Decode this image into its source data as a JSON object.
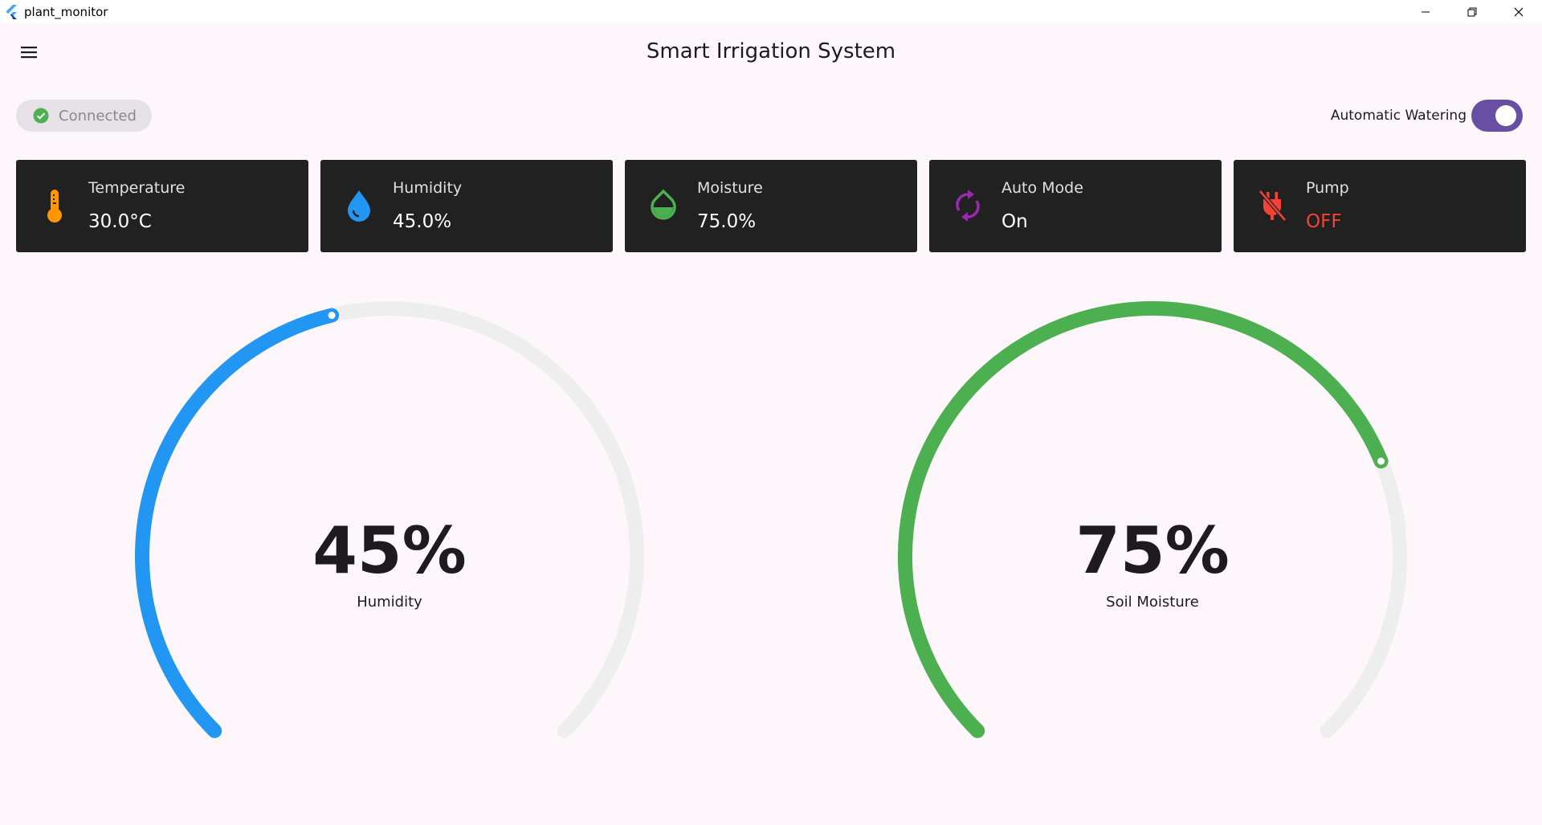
{
  "window": {
    "app_name": "plant_monitor",
    "controls": [
      "minimize-icon",
      "restore-icon",
      "close-icon"
    ]
  },
  "appbar": {
    "title": "Smart Irrigation System",
    "menu_icon": "menu-icon"
  },
  "status": {
    "connection_label": "Connected",
    "connection_icon": "check-circle-icon",
    "connection_color": "#4caf50",
    "auto_watering_label": "Automatic Watering",
    "auto_watering_on": true,
    "switch_color": "#6750a4"
  },
  "cards": [
    {
      "label": "Temperature",
      "value": "30.0°C",
      "icon": "thermometer-icon",
      "icon_color": "#ff9800"
    },
    {
      "label": "Humidity",
      "value": "45.0%",
      "icon": "water-drop-icon",
      "icon_color": "#2196f3"
    },
    {
      "label": "Moisture",
      "value": "75.0%",
      "icon": "opacity-drop-icon",
      "icon_color": "#4caf50"
    },
    {
      "label": "Auto Mode",
      "value": "On",
      "icon": "autorenew-icon",
      "icon_color": "#9c27b0"
    },
    {
      "label": "Pump",
      "value": "OFF",
      "icon": "power-off-icon",
      "icon_color": "#f44336",
      "value_color": "#f44336"
    }
  ],
  "gauges": [
    {
      "value_text": "45%",
      "label": "Humidity",
      "value": 45,
      "min": 0,
      "max": 100,
      "color": "#2196f3",
      "track_color": "#eeeeee"
    },
    {
      "value_text": "75%",
      "label": "Soil Moisture",
      "value": 75,
      "min": 0,
      "max": 100,
      "color": "#4caf50",
      "track_color": "#eeeeee"
    }
  ]
}
